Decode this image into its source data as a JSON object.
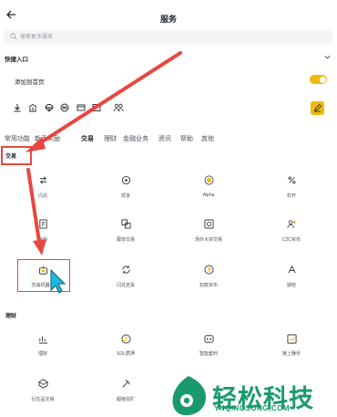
{
  "header": {
    "back_icon": "back-arrow-icon",
    "title": "服务"
  },
  "search": {
    "placeholder": "搜索更多服务"
  },
  "quick": {
    "title": "快捷入口",
    "pin_label": "添加到首页",
    "toggle_on": true,
    "icons": [
      "download-icon",
      "bank-icon",
      "parachute-icon",
      "crown-icon",
      "card-icon",
      "image-icon",
      "users-icon"
    ]
  },
  "tabs": [
    "常用功能",
    "新手奖励",
    "交易",
    "理财",
    "金融业务",
    "资讯",
    "帮助",
    "其他"
  ],
  "active_tab": "交易",
  "sections": {
    "trade": {
      "title": "交易",
      "items": [
        "闪兑",
        "现货",
        "Alpha",
        "杠杆",
        "合约",
        "跟单交易",
        "场外大宗交易",
        "C2C买币",
        "交易机器人",
        "闪兑定投",
        "扣款买币",
        "期权"
      ]
    },
    "earn": {
      "title": "理财",
      "items": [
        "理财",
        "SOL质押",
        "智能套利",
        "链上赚币",
        "衍生品交易",
        "超级挖矿"
      ]
    }
  },
  "colors": {
    "accent": "#f0b90b",
    "annotation_red": "#e8473f",
    "watermark_green": "#1a9a6c"
  },
  "watermark": {
    "text": "轻松科技",
    "url": "YNQINGSONG.COM"
  }
}
